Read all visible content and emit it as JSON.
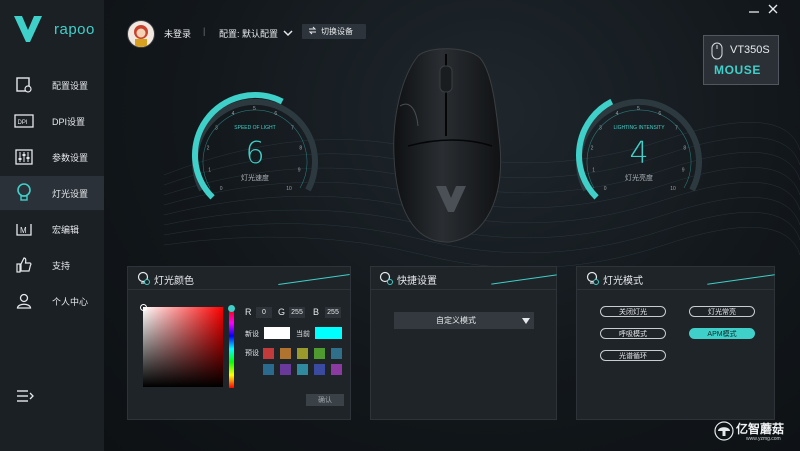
{
  "brand": {
    "logo_text": "rapoo",
    "accent": "#3fd0c9"
  },
  "sidebar": {
    "items": [
      {
        "label": "配置设置",
        "icon": "config-icon"
      },
      {
        "label": "DPI设置",
        "icon": "dpi-icon"
      },
      {
        "label": "参数设置",
        "icon": "sliders-icon"
      },
      {
        "label": "灯光设置",
        "icon": "bulb-icon",
        "active": true
      },
      {
        "label": "宏编辑",
        "icon": "macro-icon"
      },
      {
        "label": "支持",
        "icon": "thumbs-up-icon"
      },
      {
        "label": "个人中心",
        "icon": "user-icon"
      }
    ],
    "bottom_icon": "list-menu-icon"
  },
  "topbar": {
    "login": "未登录",
    "separator": "|",
    "config": "配置: 默认配置",
    "switch_device": "切换设备"
  },
  "device": {
    "model": "VT350S",
    "type": "MOUSE"
  },
  "gauges": {
    "left": {
      "caption": "SPEED OF LIGHT",
      "value": "6",
      "label": "灯光速度",
      "max": 10
    },
    "right": {
      "caption": "LIGHTING INTENSITY",
      "value": "4",
      "label": "灯光亮度",
      "max": 10
    }
  },
  "panels": {
    "color": {
      "title": "灯光颜色",
      "r_label": "R",
      "r_value": "0",
      "g_label": "G",
      "g_value": "255",
      "b_label": "B",
      "b_value": "255",
      "new_label": "新设",
      "current_label": "当前",
      "preset_label": "预设",
      "new_color": "#ffffff",
      "current_color": "#00ffff",
      "confirm": "确认",
      "presets": [
        "#c23a3a",
        "#b0742e",
        "#9a9a2a",
        "#4f9a2e",
        "#2f6f8a",
        "#2a6a8f",
        "#6a3a9a",
        "#2f8aa0",
        "#3a4aa0",
        "#8a3aa0"
      ]
    },
    "quick": {
      "title": "快捷设置",
      "selected": "自定义模式"
    },
    "mode": {
      "title": "灯光模式",
      "buttons": [
        "关闭灯光",
        "灯光常亮",
        "呼吸模式",
        "APM模式",
        "光谱循环"
      ],
      "active": "APM模式"
    }
  },
  "watermark": {
    "text": "亿智蘑菇",
    "url": "www.yzmg.com"
  }
}
